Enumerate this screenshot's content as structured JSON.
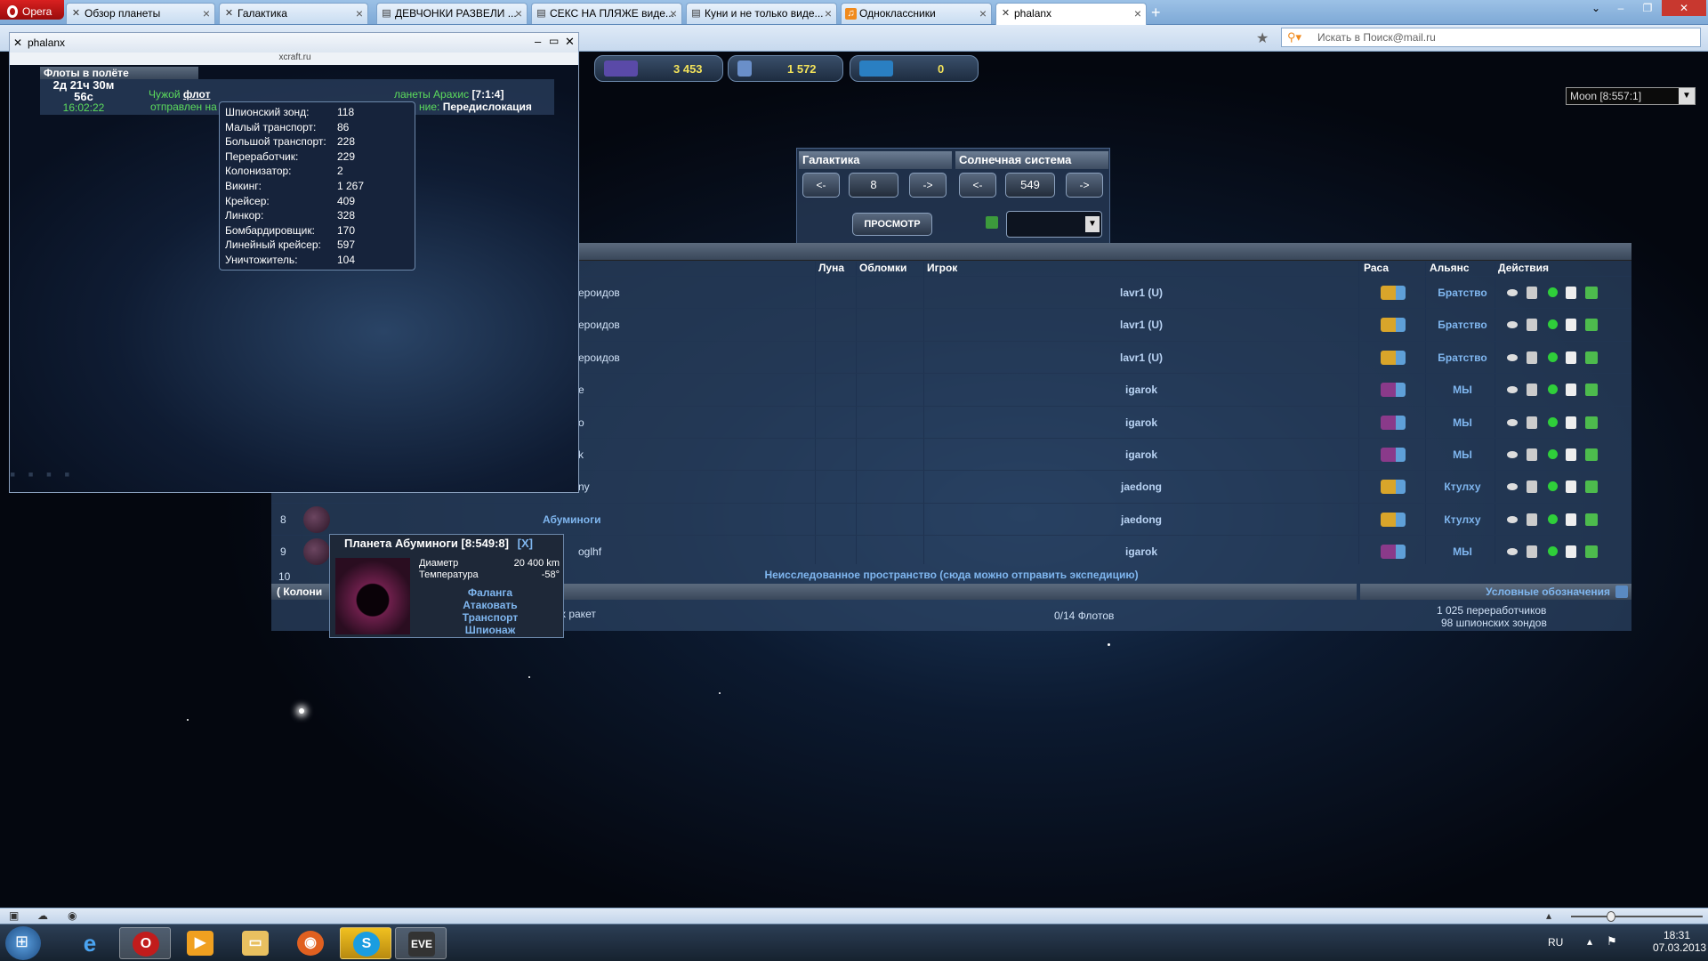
{
  "browser": {
    "menu_label": "Opera",
    "tabs": [
      {
        "label": "Обзор планеты"
      },
      {
        "label": "Галактика"
      },
      {
        "label": "ДЕВЧОНКИ РАЗВЕЛИ ..."
      },
      {
        "label": "СЕКС НА ПЛЯЖЕ виде..."
      },
      {
        "label": "Куни и не только виде..."
      },
      {
        "label": "Одноклассники"
      },
      {
        "label": "phalanx"
      }
    ],
    "search_placeholder": "Искать в Поиск@mail.ru"
  },
  "resources": [
    {
      "value": "3 453",
      "color": "#5a4aa8"
    },
    {
      "value": "1 572",
      "color": "#6a8fc9"
    },
    {
      "value": "0",
      "color": "#2a7fc2"
    }
  ],
  "moon_select": "Moon [8:557:1]",
  "galaxy_nav": {
    "galaxy_label": "Галактика",
    "system_label": "Солнечная система",
    "prev": "<-",
    "next": "->",
    "galaxy_value": "8",
    "system_value": "549",
    "view_button": "ПРОСМОТР"
  },
  "table": {
    "headers": {
      "moon": "Луна",
      "debris": "Обломки",
      "player": "Игрок",
      "race": "Раса",
      "alliance": "Альянс",
      "actions": "Действия"
    },
    "rows": [
      {
        "num": "",
        "planet": "ероидов",
        "player": "lavr1 (U)",
        "alliance": "Братство",
        "race": "#d9a52a"
      },
      {
        "num": "",
        "planet": "ероидов",
        "player": "lavr1 (U)",
        "alliance": "Братство",
        "race": "#d9a52a"
      },
      {
        "num": "",
        "planet": "ероидов",
        "player": "lavr1 (U)",
        "alliance": "Братство",
        "race": "#d9a52a"
      },
      {
        "num": "",
        "planet": "е",
        "player": "igarok",
        "alliance": "МЫ",
        "race": "#8a3a8a"
      },
      {
        "num": "",
        "planet": "о",
        "player": "igarok",
        "alliance": "МЫ",
        "race": "#8a3a8a"
      },
      {
        "num": "",
        "planet": "k",
        "player": "igarok",
        "alliance": "МЫ",
        "race": "#8a3a8a"
      },
      {
        "num": "",
        "planet": "ny",
        "player": "jaedong",
        "alliance": "Ктулху",
        "race": "#d9a52a"
      },
      {
        "num": "8",
        "planet": "Абуминоги",
        "player": "jaedong",
        "alliance": "Ктулху",
        "race": "#d9a52a"
      },
      {
        "num": "9",
        "planet": "oglhf",
        "player": "igarok",
        "alliance": "МЫ",
        "race": "#8a3a8a"
      }
    ],
    "row10_num": "10",
    "explore_text": "Неисследованное пространство (сюда можно отправить экспедицию)",
    "footer_left": "( Колони",
    "footer_legend": "Условные обозначения",
    "missiles": "х ракет",
    "fleets": "0/14 Флотов",
    "recyclers": "1 025 переработчиков",
    "spies": "98 шпионских зондов"
  },
  "phalanx": {
    "title": "phalanx",
    "url": "xcraft.ru",
    "fleets_title": "Флоты в полёте",
    "time_left": "2д 21ч 30м",
    "time_sec": "56с",
    "time_clock": "16:02:22",
    "info_line1_a": "Чужой",
    "info_line1_b": "флот",
    "info_line1_c": "ланеты Арахис",
    "info_coords": "[7:1:4]",
    "info_line2_a": "отправлен на",
    "info_line2_b": "ние:",
    "info_mission": "Передислокация",
    "ships": [
      {
        "name": "Шпионский зонд:",
        "count": "118"
      },
      {
        "name": "Малый транспорт:",
        "count": "86"
      },
      {
        "name": "Большой транспорт:",
        "count": "228"
      },
      {
        "name": "Переработчик:",
        "count": "229"
      },
      {
        "name": "Колонизатор:",
        "count": "2"
      },
      {
        "name": "Викинг:",
        "count": "1 267"
      },
      {
        "name": "Крейсер:",
        "count": "409"
      },
      {
        "name": "Линкор:",
        "count": "328"
      },
      {
        "name": "Бомбардировщик:",
        "count": "170"
      },
      {
        "name": "Линейный крейсер:",
        "count": "597"
      },
      {
        "name": "Уничтожитель:",
        "count": "104"
      }
    ]
  },
  "planet_popup": {
    "title": "Планета Абуминоги [8:549:8]",
    "close": "[X]",
    "diameter_label": "Диаметр",
    "diameter": "20 400 km",
    "temp_label": "Температура",
    "temp": "-58°",
    "links": [
      "Фаланга",
      "Атаковать",
      "Транспорт",
      "Шпионаж"
    ]
  },
  "tray": {
    "lang": "RU",
    "time": "18:31",
    "date": "07.03.2013"
  }
}
